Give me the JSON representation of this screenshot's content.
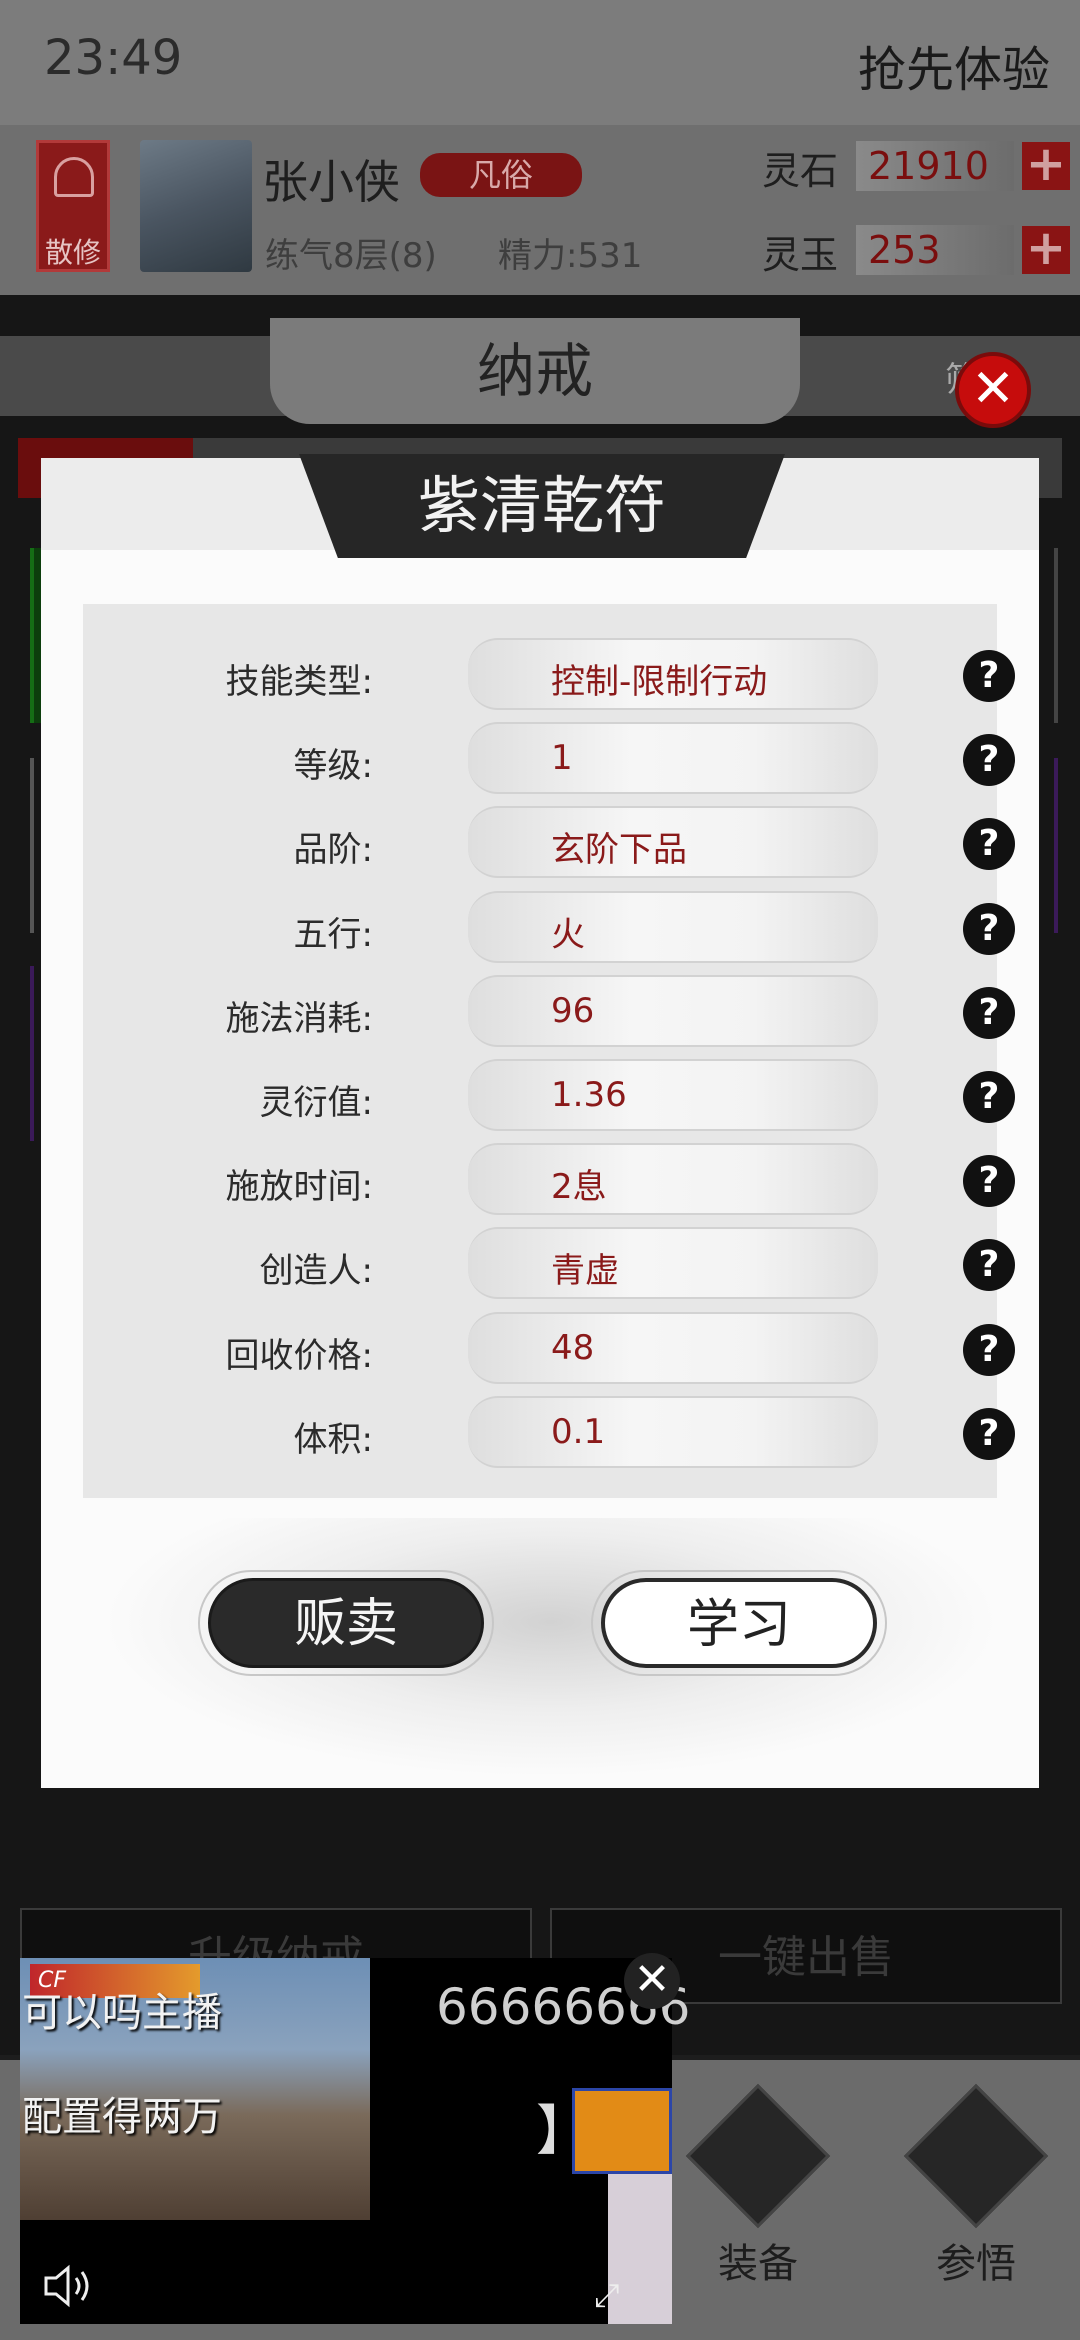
{
  "status_bar": {
    "time": "23:49",
    "trial": "抢先体验"
  },
  "player": {
    "sect": "散修",
    "name": "张小侠",
    "rank": "凡俗",
    "realm": "练气8层(8)",
    "energy": "精力:531",
    "resources": [
      {
        "label": "灵石",
        "value": "21910",
        "plus": "+"
      },
      {
        "label": "灵玉",
        "value": "253",
        "plus": "+"
      }
    ]
  },
  "screen": {
    "title": "纳戒",
    "filter_label": "筛"
  },
  "modal": {
    "title": "紫清乾符",
    "attributes": [
      {
        "label": "技能类型:",
        "value": "控制-限制行动"
      },
      {
        "label": "等级:",
        "value": "1"
      },
      {
        "label": "品阶:",
        "value": "玄阶下品"
      },
      {
        "label": "五行:",
        "value": "火"
      },
      {
        "label": "施法消耗:",
        "value": "96"
      },
      {
        "label": "灵衍值:",
        "value": "1.36"
      },
      {
        "label": "施放时间:",
        "value": "2息"
      },
      {
        "label": "创造人:",
        "value": "青虚"
      },
      {
        "label": "回收价格:",
        "value": "48"
      },
      {
        "label": "体积:",
        "value": "0.1"
      }
    ],
    "help_glyph": "?",
    "sell_label": "贩卖",
    "learn_label": "学习",
    "close_glyph": "✕"
  },
  "bottom_actions": {
    "upgrade": "升级纳戒",
    "sell_all": "一键出售"
  },
  "bottom_nav": [
    {
      "label": "装备",
      "icon": "sword-icon"
    },
    {
      "label": "参悟",
      "icon": "book-icon"
    }
  ],
  "video_ad": {
    "caption1": "可以吗主播",
    "caption2": "配置得两万",
    "danmu": "66666666",
    "close_glyph": "✕"
  },
  "colors": {
    "accent_red": "#8a1a1a",
    "close_red": "#c60c0c",
    "modal_bg": "#fbfbfb"
  }
}
